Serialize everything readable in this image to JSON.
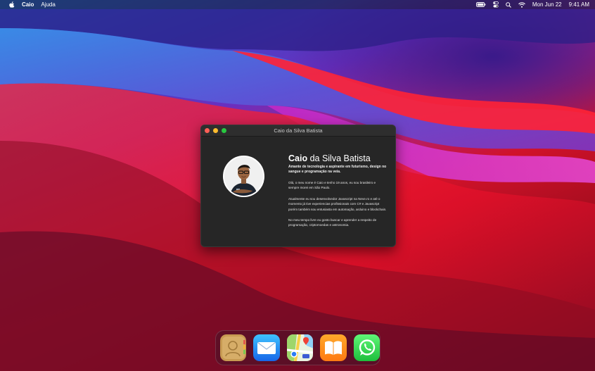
{
  "menubar": {
    "app_name": "Caio",
    "menu_help": "Ajuda",
    "date": "Mon Jun 22",
    "time": "9:41 AM",
    "icons": [
      "apple-icon",
      "battery-icon",
      "control-center-icon",
      "search-icon",
      "wifi-icon"
    ]
  },
  "window": {
    "title": "Caio da Silva Batista",
    "name_first": "Caio",
    "name_rest": " da Silva Batista",
    "tagline": "Amante de tecnologia e aspirante em futurismo, design no sangue e programação na veia.",
    "paragraphs": [
      "Olá, o meu nome é Caio e tenho 19 anos, eu sou brasileiro e sempre morei em São Paulo.",
      "Atualmente eu sou desenvolvedor Javascript na Neve.ro e até o momento já tive experiencias profissionais com C# e Javascript porém também sou entusiasta em automação, arduino e blockchain.",
      "No meu tempo livre eu gosto buscar e aprender a respeito de programação, criptomoedas e astronomia."
    ]
  },
  "dock": {
    "items": [
      "contacts-icon",
      "mail-icon",
      "maps-icon",
      "books-icon",
      "whatsapp-icon"
    ]
  },
  "colors": {
    "window_bg": "#262626",
    "close": "#ff5f57",
    "minimize": "#febc2e",
    "maximize": "#28c840"
  }
}
